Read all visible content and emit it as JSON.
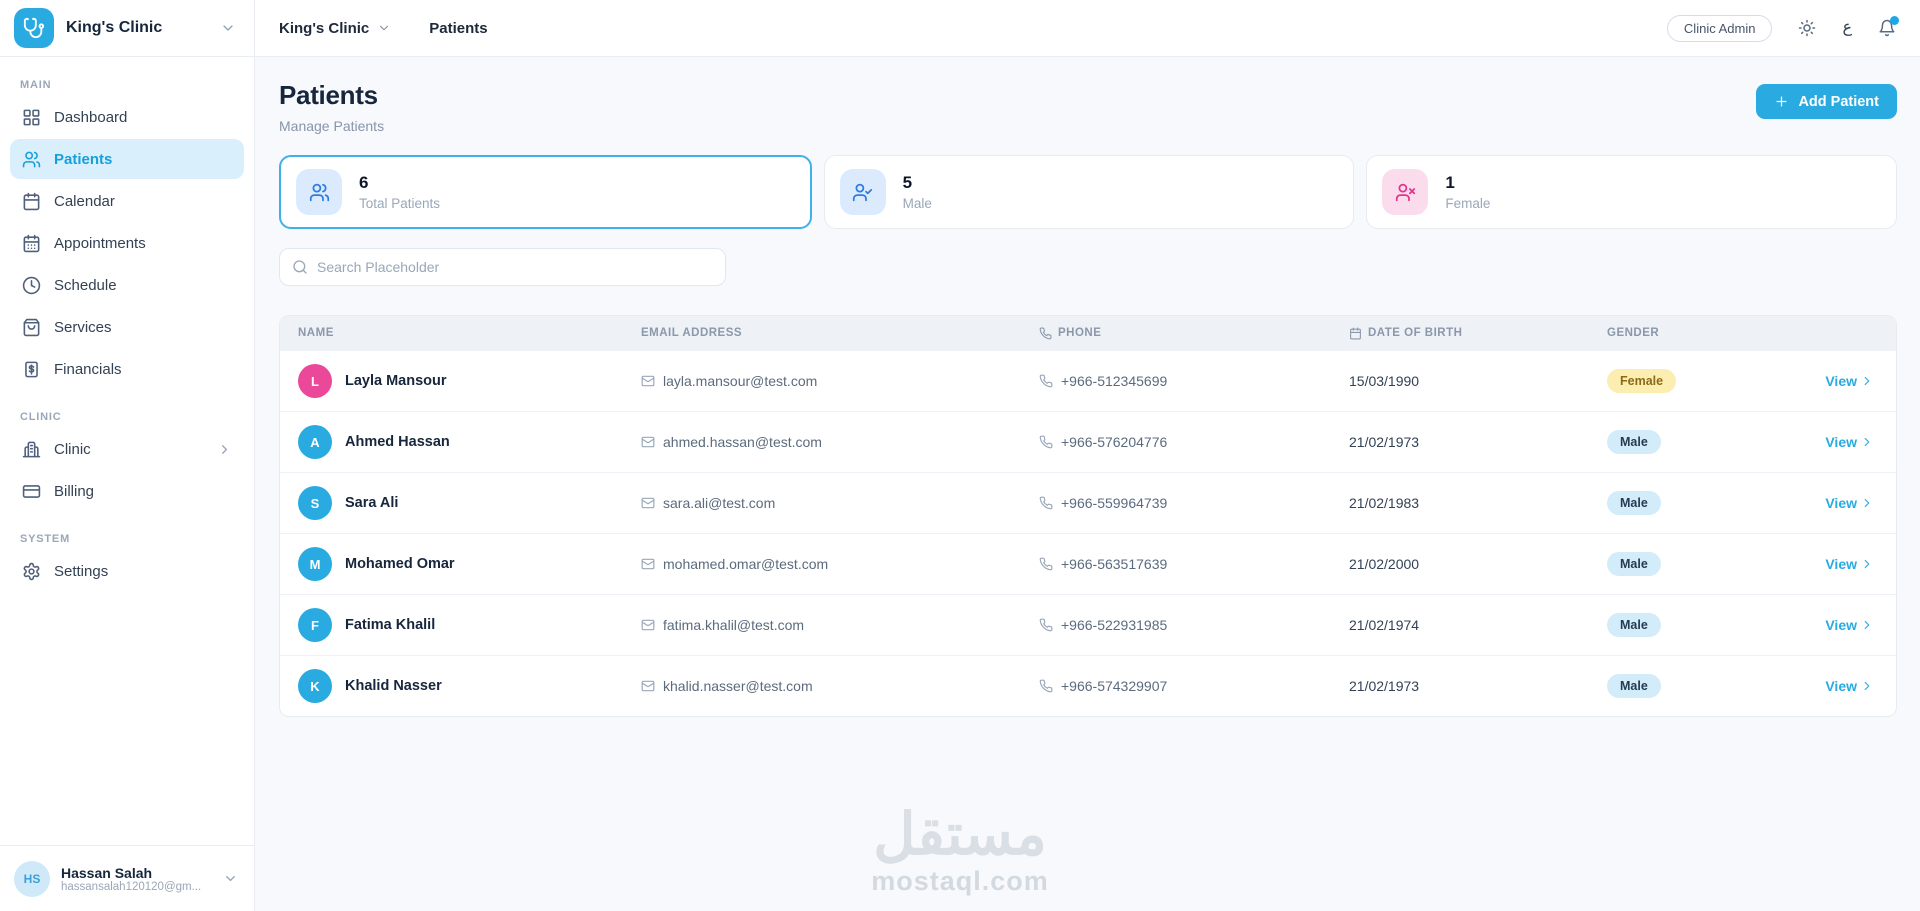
{
  "brand": {
    "name": "King's Clinic"
  },
  "topbar": {
    "breadcrumb_clinic": "King's Clinic",
    "breadcrumb_page": "Patients",
    "role_badge": "Clinic Admin",
    "language": "ع"
  },
  "sidebar": {
    "sections": [
      {
        "label": "MAIN",
        "items": [
          {
            "label": "Dashboard",
            "icon": "dashboard-grid-icon"
          },
          {
            "label": "Patients",
            "icon": "patients-users-icon",
            "active": true
          },
          {
            "label": "Calendar",
            "icon": "calendar-icon"
          },
          {
            "label": "Appointments",
            "icon": "calendar-days-icon"
          },
          {
            "label": "Schedule",
            "icon": "clock-icon"
          },
          {
            "label": "Services",
            "icon": "shopping-bag-icon"
          },
          {
            "label": "Financials",
            "icon": "dollar-receipt-icon"
          }
        ]
      },
      {
        "label": "CLINIC",
        "items": [
          {
            "label": "Clinic",
            "icon": "building-icon",
            "has_submenu": true
          },
          {
            "label": "Billing",
            "icon": "credit-card-icon"
          }
        ]
      },
      {
        "label": "SYSTEM",
        "items": [
          {
            "label": "Settings",
            "icon": "gear-icon"
          }
        ]
      }
    ]
  },
  "page": {
    "title": "Patients",
    "subtitle": "Manage Patients",
    "add_button": "Add Patient"
  },
  "stats": [
    {
      "value": "6",
      "label": "Total Patients",
      "icon": "users-icon",
      "selected": true
    },
    {
      "value": "5",
      "label": "Male",
      "icon": "user-check-icon"
    },
    {
      "value": "1",
      "label": "Female",
      "icon": "user-x-icon"
    }
  ],
  "search": {
    "placeholder": "Search Placeholder"
  },
  "table": {
    "headers": [
      "NAME",
      "EMAIL ADDRESS",
      "PHONE",
      "DATE OF BIRTH",
      "GENDER"
    ],
    "view_label": "View",
    "rows": [
      {
        "initial": "L",
        "name": "Layla Mansour",
        "email": "layla.mansour@test.com",
        "phone": "+966-512345699",
        "dob": "15/03/1990",
        "gender": "Female"
      },
      {
        "initial": "A",
        "name": "Ahmed Hassan",
        "email": "ahmed.hassan@test.com",
        "phone": "+966-576204776",
        "dob": "21/02/1973",
        "gender": "Male"
      },
      {
        "initial": "S",
        "name": "Sara Ali",
        "email": "sara.ali@test.com",
        "phone": "+966-559964739",
        "dob": "21/02/1983",
        "gender": "Male"
      },
      {
        "initial": "M",
        "name": "Mohamed Omar",
        "email": "mohamed.omar@test.com",
        "phone": "+966-563517639",
        "dob": "21/02/2000",
        "gender": "Male"
      },
      {
        "initial": "F",
        "name": "Fatima Khalil",
        "email": "fatima.khalil@test.com",
        "phone": "+966-522931985",
        "dob": "21/02/1974",
        "gender": "Male"
      },
      {
        "initial": "K",
        "name": "Khalid Nasser",
        "email": "khalid.nasser@test.com",
        "phone": "+966-574329907",
        "dob": "21/02/1973",
        "gender": "Male"
      }
    ]
  },
  "user": {
    "initials": "HS",
    "name": "Hassan Salah",
    "email": "hassansalah120120@gm..."
  },
  "watermark": {
    "arabic": "مستقل",
    "domain": "mostaql.com"
  },
  "colors": {
    "accent": "#29abe2",
    "active_item_bg": "#d9effb",
    "avatar_pink": "#ec4899",
    "stat_chip_blue_bg": "#dbeafd",
    "stat_chip_blue_icon": "#2b7de0",
    "stat_chip_pink_bg": "#fbdcec",
    "stat_chip_pink_icon": "#e2348c",
    "badge_male_bg": "#d3ecfa",
    "badge_female_bg": "#fceeb0",
    "table_header_bg": "#eef1f6",
    "notification_dot": "#1ea7e8"
  }
}
